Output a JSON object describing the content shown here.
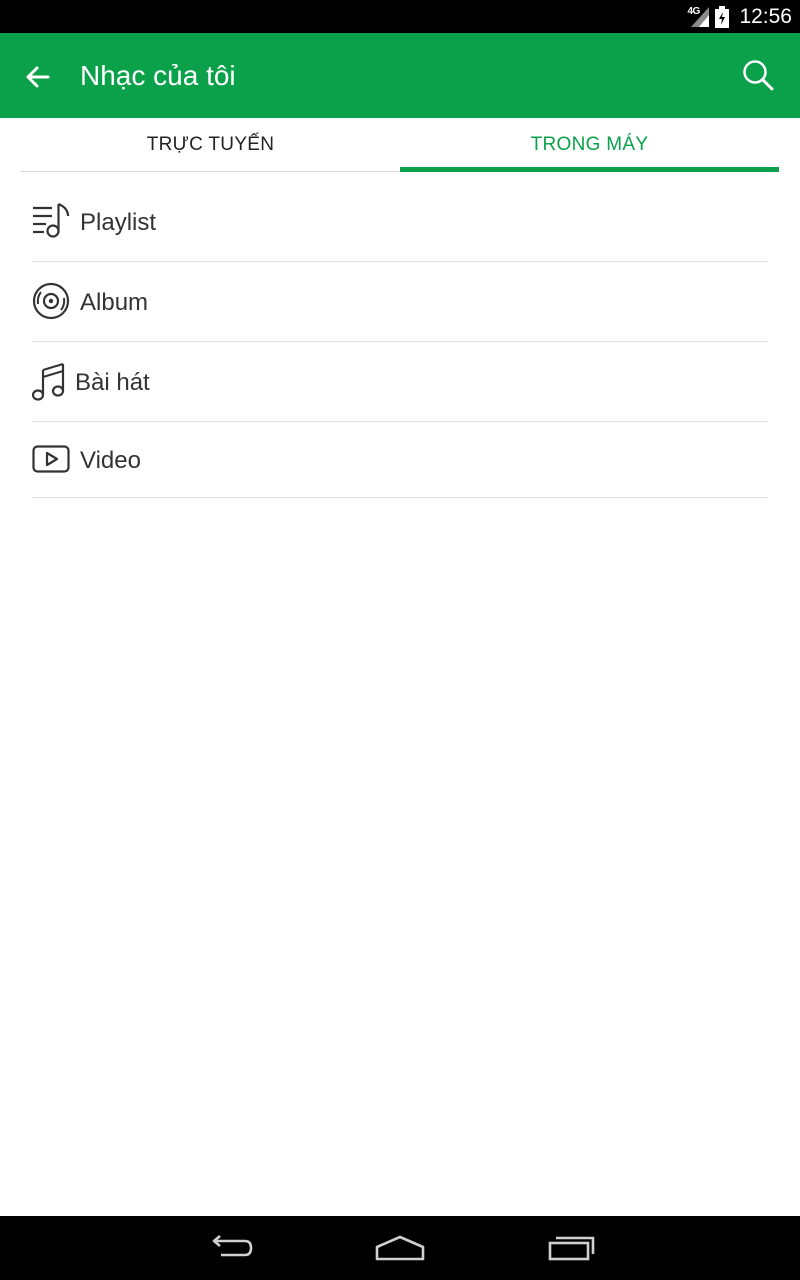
{
  "status_bar": {
    "network": "4G",
    "time": "12:56"
  },
  "app_bar": {
    "title": "Nhạc của tôi",
    "back_icon": "arrow-left-icon",
    "search_icon": "search-icon",
    "color": "#0aa14a"
  },
  "tabs": [
    {
      "label": "TRỰC TUYẾN",
      "selected": false
    },
    {
      "label": "TRONG MÁY",
      "selected": true
    }
  ],
  "menu": {
    "items": [
      {
        "label": "Playlist",
        "icon": "playlist-icon"
      },
      {
        "label": "Album",
        "icon": "album-disc-icon"
      },
      {
        "label": "Bài hát",
        "icon": "music-note-icon"
      },
      {
        "label": "Video",
        "icon": "video-play-icon"
      }
    ]
  },
  "nav_bar": {
    "back": "nav-back-icon",
    "home": "nav-home-icon",
    "recents": "nav-recents-icon"
  },
  "colors": {
    "accent": "#0aa14a",
    "text": "#333333",
    "divider": "#e0e0e0"
  }
}
